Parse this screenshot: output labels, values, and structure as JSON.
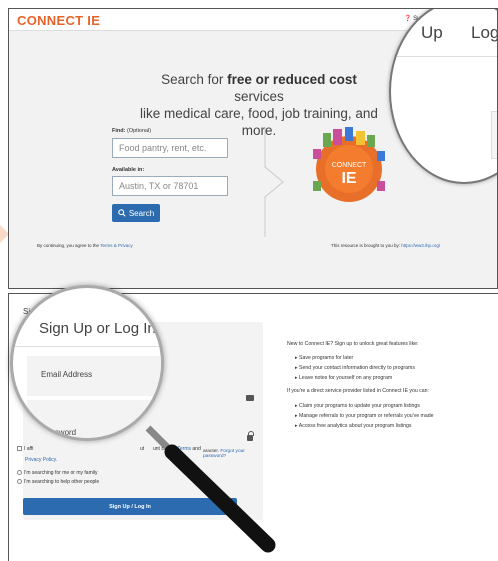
{
  "top": {
    "logo": "CONNECT IE",
    "support": "Supp",
    "magnifier": {
      "signup": "Up",
      "login": "Log I"
    },
    "hero": {
      "line_pre": "Search for ",
      "line_bold": "free or reduced cost",
      "line_post": " services",
      "line2": "like medical care, food, job training, and",
      "line3": "more."
    },
    "find_label_bold": "Find:",
    "find_label_rest": " (Optional)",
    "find_placeholder": "Food pantry, rent, etc.",
    "available_label": "Available in:",
    "available_placeholder": "Austin, TX or 78701",
    "search_button": "Search",
    "badge_line1": "CONNECT",
    "badge_line2": "IE",
    "continuing_text": "By continuing, you agree to the ",
    "continuing_link": "Terms & Privacy",
    "brought_text": "This resource is brought to you by: ",
    "brought_link": "https://ww3.ihp.org/"
  },
  "bottom": {
    "shot_label": "Si",
    "magnifier": {
      "title": "Sign Up or Log In",
      "email_label": "Email Address",
      "password_label": "Password"
    },
    "forgot_pre": "aracter. ",
    "forgot_link": "Forgot your password?",
    "agree_partial": "I affi",
    "agree_mid": "ut",
    "agree_bertha_pre": "unt Bertha ",
    "agree_terms": "Terms",
    "agree_and": " and",
    "privacy_link": "Privacy Policy.",
    "radio_1": "I'm searching for me or my family",
    "radio_2": "I'm searching to help other people",
    "signup_button": "Sign Up / Log In",
    "right": {
      "intro": "New to Connect IE? Sign up to unlock great features like:",
      "features": [
        "Save programs for later",
        "Send your contact information directly to programs",
        "Leave notes for yourself on any program"
      ],
      "provider_intro": "If you're a direct service provider listed in Connect IE you can:",
      "provider_features": [
        "Claim your programs to update your program listings",
        "Manage referrals to your program or referrals you've made",
        "Access free analytics about your program listings"
      ]
    }
  },
  "colors": {
    "brand_orange": "#e8632b",
    "brand_blue": "#2c6bb0",
    "badge_orange": "#e86f2a"
  }
}
